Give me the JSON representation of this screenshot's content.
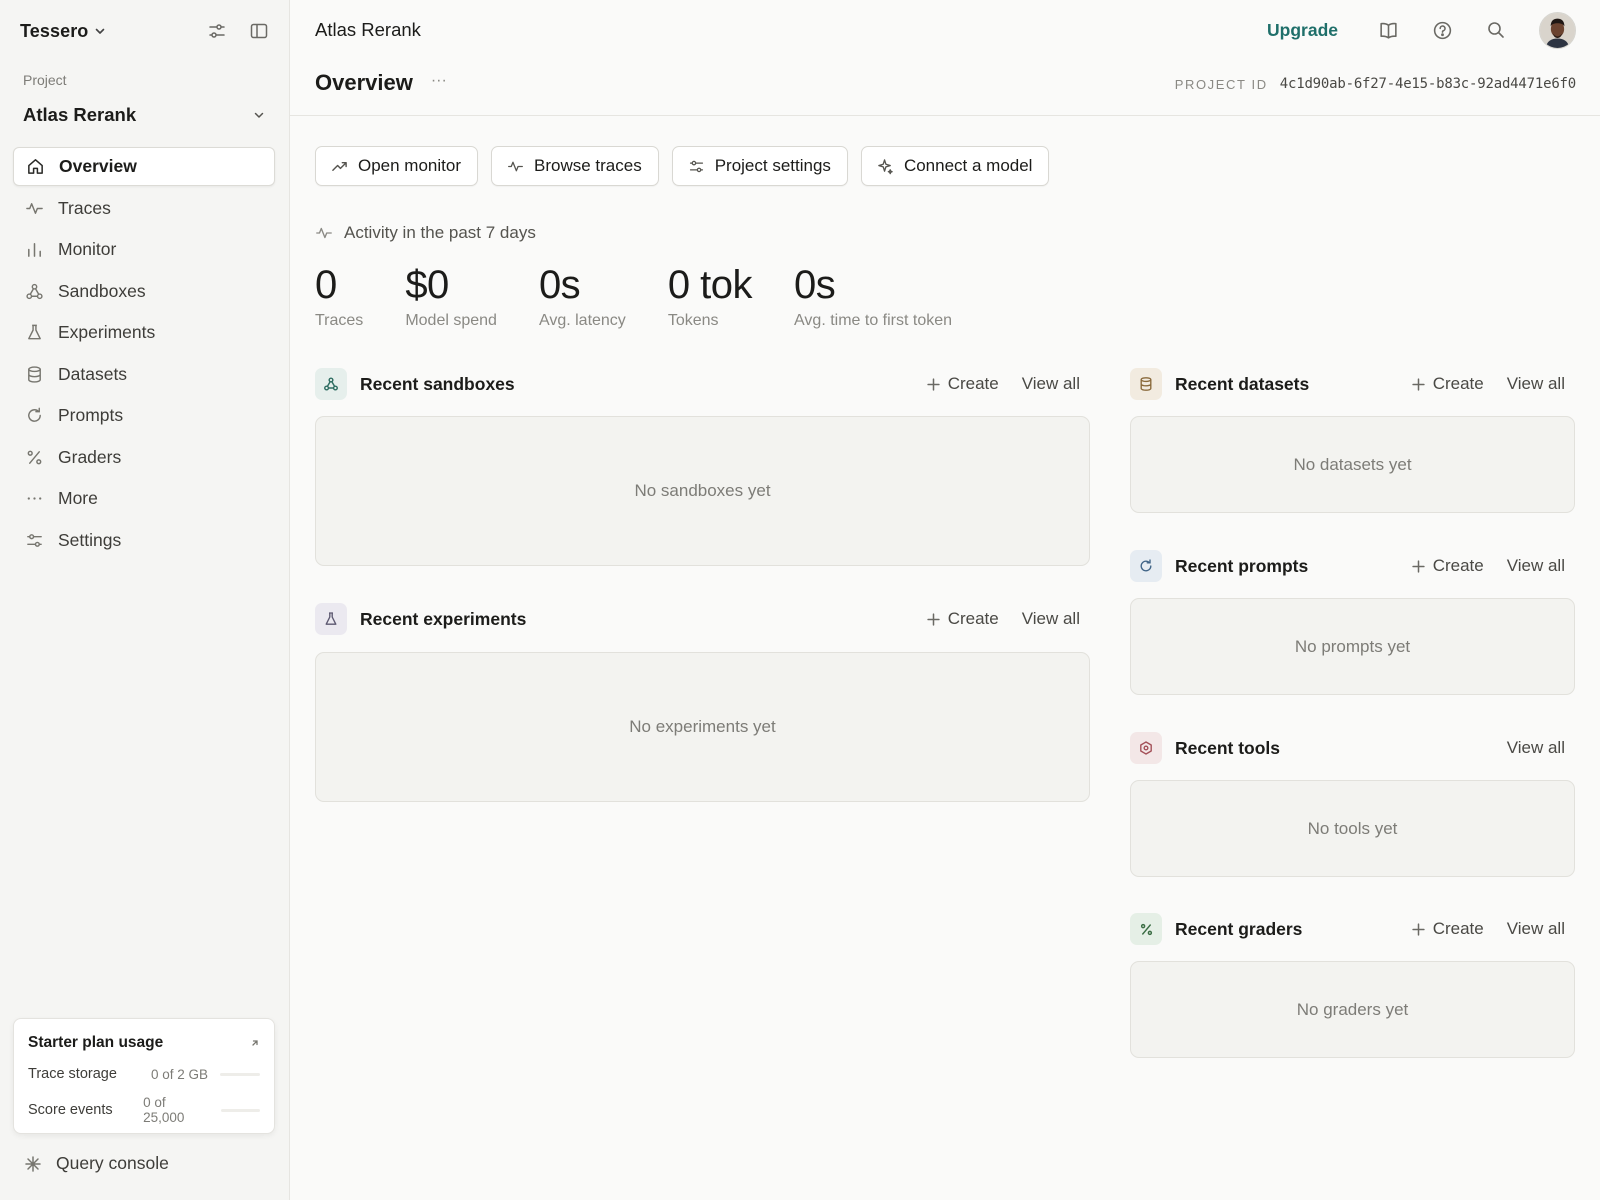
{
  "workspace": {
    "name": "Tessero"
  },
  "project": {
    "label": "Project",
    "name": "Atlas Rerank"
  },
  "nav": [
    {
      "label": "Overview",
      "icon": "home-icon",
      "active": true
    },
    {
      "label": "Traces",
      "icon": "activity-icon"
    },
    {
      "label": "Monitor",
      "icon": "bar-chart-icon"
    },
    {
      "label": "Sandboxes",
      "icon": "nodes-icon"
    },
    {
      "label": "Experiments",
      "icon": "flask-icon"
    },
    {
      "label": "Datasets",
      "icon": "database-icon"
    },
    {
      "label": "Prompts",
      "icon": "refresh-icon"
    },
    {
      "label": "Graders",
      "icon": "percent-icon"
    },
    {
      "label": "More",
      "icon": "ellipsis-icon"
    },
    {
      "label": "Settings",
      "icon": "sliders-icon"
    }
  ],
  "usage": {
    "title": "Starter plan usage",
    "rows": [
      {
        "label": "Trace storage",
        "value": "0 of 2 GB",
        "fraction": 0
      },
      {
        "label": "Score events",
        "value": "0 of 25,000",
        "fraction": 0
      }
    ]
  },
  "console": {
    "label": "Query console"
  },
  "topbar": {
    "breadcrumb": "Atlas Rerank",
    "upgrade": "Upgrade"
  },
  "page": {
    "title": "Overview",
    "more": "···",
    "project_id_label": "PROJECT ID",
    "project_id": "4c1d90ab-6f27-4e15-b83c-92ad4471e6f0"
  },
  "quick_actions": {
    "open_monitor": "Open monitor",
    "browse_traces": "Browse traces",
    "project_settings": "Project settings",
    "connect_model": "Connect a model"
  },
  "activity": {
    "label": "Activity in the past 7 days"
  },
  "stats": [
    {
      "value": "0",
      "label": "Traces"
    },
    {
      "value": "$0",
      "label": "Model spend"
    },
    {
      "value": "0s",
      "label": "Avg. latency"
    },
    {
      "value": "0 tok",
      "label": "Tokens"
    },
    {
      "value": "0s",
      "label": "Avg. time to first token"
    }
  ],
  "sections": {
    "create": "Create",
    "view_all": "View all",
    "sandboxes": {
      "title": "Recent sandboxes",
      "empty": "No sandboxes yet",
      "color": "#e6efec"
    },
    "experiments": {
      "title": "Recent experiments",
      "empty": "No experiments yet",
      "color": "#ebe9f0"
    },
    "datasets": {
      "title": "Recent datasets",
      "empty": "No datasets yet",
      "color": "#f2ebe0"
    },
    "prompts": {
      "title": "Recent prompts",
      "empty": "No prompts yet",
      "color": "#e6ecf2"
    },
    "tools": {
      "title": "Recent tools",
      "empty": "No tools yet",
      "color": "#f3e7e7"
    },
    "graders": {
      "title": "Recent graders",
      "empty": "No graders yet",
      "color": "#e5efe6"
    }
  },
  "colors": {
    "accent": "#1f6f6a"
  }
}
